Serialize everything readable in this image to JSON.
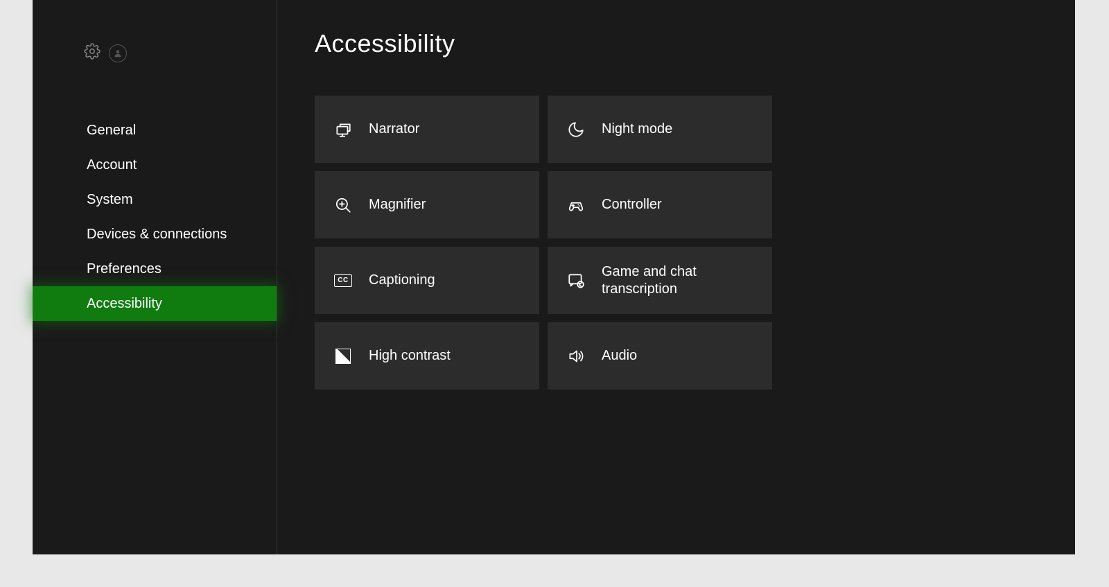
{
  "page": {
    "title": "Accessibility"
  },
  "sidebar": {
    "items": [
      {
        "label": "General"
      },
      {
        "label": "Account"
      },
      {
        "label": "System"
      },
      {
        "label": "Devices & connections"
      },
      {
        "label": "Preferences"
      },
      {
        "label": "Accessibility"
      }
    ]
  },
  "tiles": [
    {
      "label": "Narrator"
    },
    {
      "label": "Night mode"
    },
    {
      "label": "Magnifier"
    },
    {
      "label": "Controller"
    },
    {
      "label": "Captioning"
    },
    {
      "label": "Game and chat transcription"
    },
    {
      "label": "High contrast"
    },
    {
      "label": "Audio"
    }
  ],
  "captioning_badge": "CC"
}
